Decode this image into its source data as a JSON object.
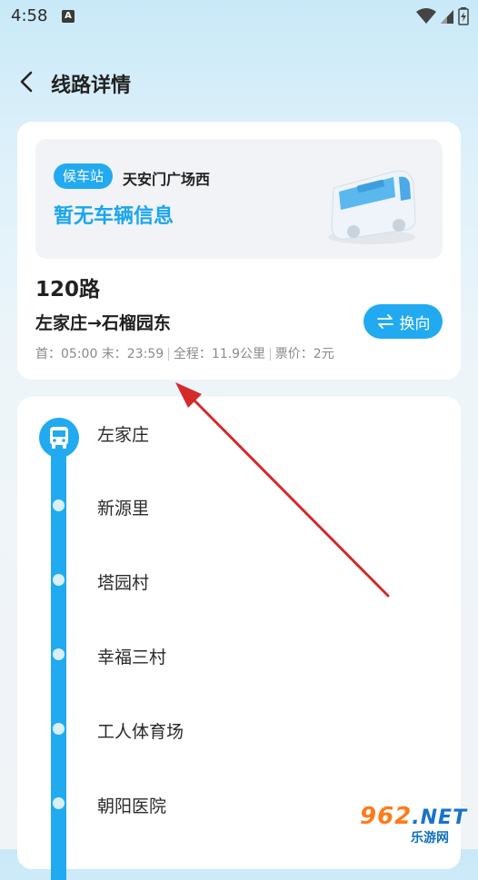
{
  "status_bar": {
    "time": "4:58",
    "notification_glyph": "A"
  },
  "nav": {
    "title": "线路详情",
    "back_icon": "chevron-left-icon"
  },
  "wait": {
    "tag": "候车站",
    "stop": "天安门广场西",
    "message": "暂无车辆信息"
  },
  "route": {
    "name": "120路",
    "direction": "左家庄→石榴园东",
    "swap_label": "换向",
    "first": "首：05:00",
    "last": "末：23:59",
    "length": "全程：11.9公里",
    "fare": "票价：2元"
  },
  "stops": [
    "左家庄",
    "新源里",
    "塔园村",
    "幸福三村",
    "工人体育场",
    "朝阳医院"
  ],
  "watermark": {
    "number": "962",
    "suffix": ".NET",
    "site": "乐游网"
  },
  "colors": {
    "accent": "#22aaf0",
    "arrow": "#d42a2a"
  }
}
